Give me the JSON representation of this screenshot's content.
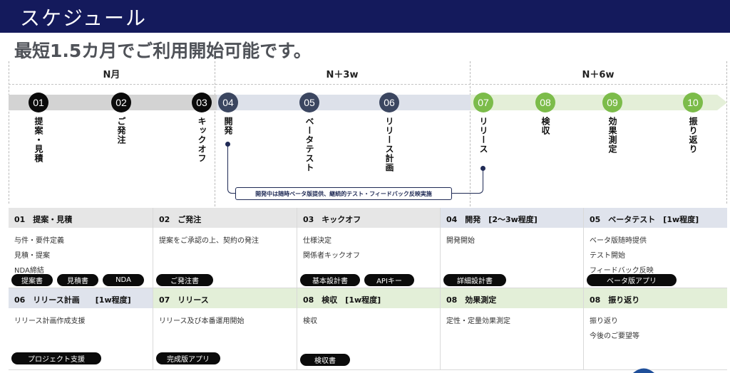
{
  "header": {
    "title": "スケジュール"
  },
  "subtitle": "最短1.5カ月でご利用開始可能です。",
  "phases": [
    "N月",
    "N＋3w",
    "N＋6w"
  ],
  "colors": {
    "header": "#141a5c",
    "step_black": "#0b0b0b",
    "step_navy": "#3b4660",
    "step_green": "#7cbc4a"
  },
  "steps": [
    {
      "num": "01",
      "label": "提案・見積"
    },
    {
      "num": "02",
      "label": "ご発注"
    },
    {
      "num": "03",
      "label": "キックオフ"
    },
    {
      "num": "04",
      "label": "開発"
    },
    {
      "num": "05",
      "label": "ベータテスト"
    },
    {
      "num": "06",
      "label": "リリース計画"
    },
    {
      "num": "07",
      "label": "リリース"
    },
    {
      "num": "08",
      "label": "検収"
    },
    {
      "num": "09",
      "label": "効果測定"
    },
    {
      "num": "10",
      "label": "振り返り"
    }
  ],
  "note": "開発中は随時ベータ版提供、継続的テスト・フィードバック反映実施",
  "table": {
    "row1": [
      {
        "title": "01　提案・見積",
        "items": [
          "与件・要件定義",
          "見積・提案",
          "NDA締結"
        ],
        "tags": [
          "提案書",
          "見積書",
          "NDA"
        ]
      },
      {
        "title": "02　ご発注",
        "items": [
          "提案をご承認の上、契約の発注"
        ],
        "tags": [
          "ご発注書"
        ]
      },
      {
        "title": "03　キックオフ",
        "items": [
          "仕様決定",
          "関係者キックオフ"
        ],
        "tags": [
          "基本設計書",
          "APIキー"
        ]
      },
      {
        "title": "04　開発　[2〜3w程度]",
        "items": [
          "開発開始"
        ],
        "tags": [
          "詳細設計書"
        ]
      },
      {
        "title": "05　ベータテスト　[1w程度]",
        "items": [
          "ベータ版随時提供",
          "テスト開始",
          "フィードバック反映"
        ],
        "tags": [
          "ベータ版アプリ"
        ]
      }
    ],
    "row2": [
      {
        "title": "06　リリース計画　　[1w程度]",
        "items": [
          "リリース計画作成支援"
        ],
        "tags": [
          "プロジェクト支援"
        ]
      },
      {
        "title": "07　リリース",
        "items": [
          "リリース及び本番運用開始"
        ],
        "tags": [
          "完成版アプリ"
        ]
      },
      {
        "title": "08　検収　[1w程度]",
        "items": [
          "検収"
        ],
        "tags": [
          "検収書"
        ]
      },
      {
        "title": "08　効果測定",
        "items": [
          "定性・定量効果測定"
        ],
        "tags": []
      },
      {
        "title": "08　振り返り",
        "items": [
          "振り返り",
          "今後のご要望等"
        ],
        "tags": []
      }
    ]
  }
}
